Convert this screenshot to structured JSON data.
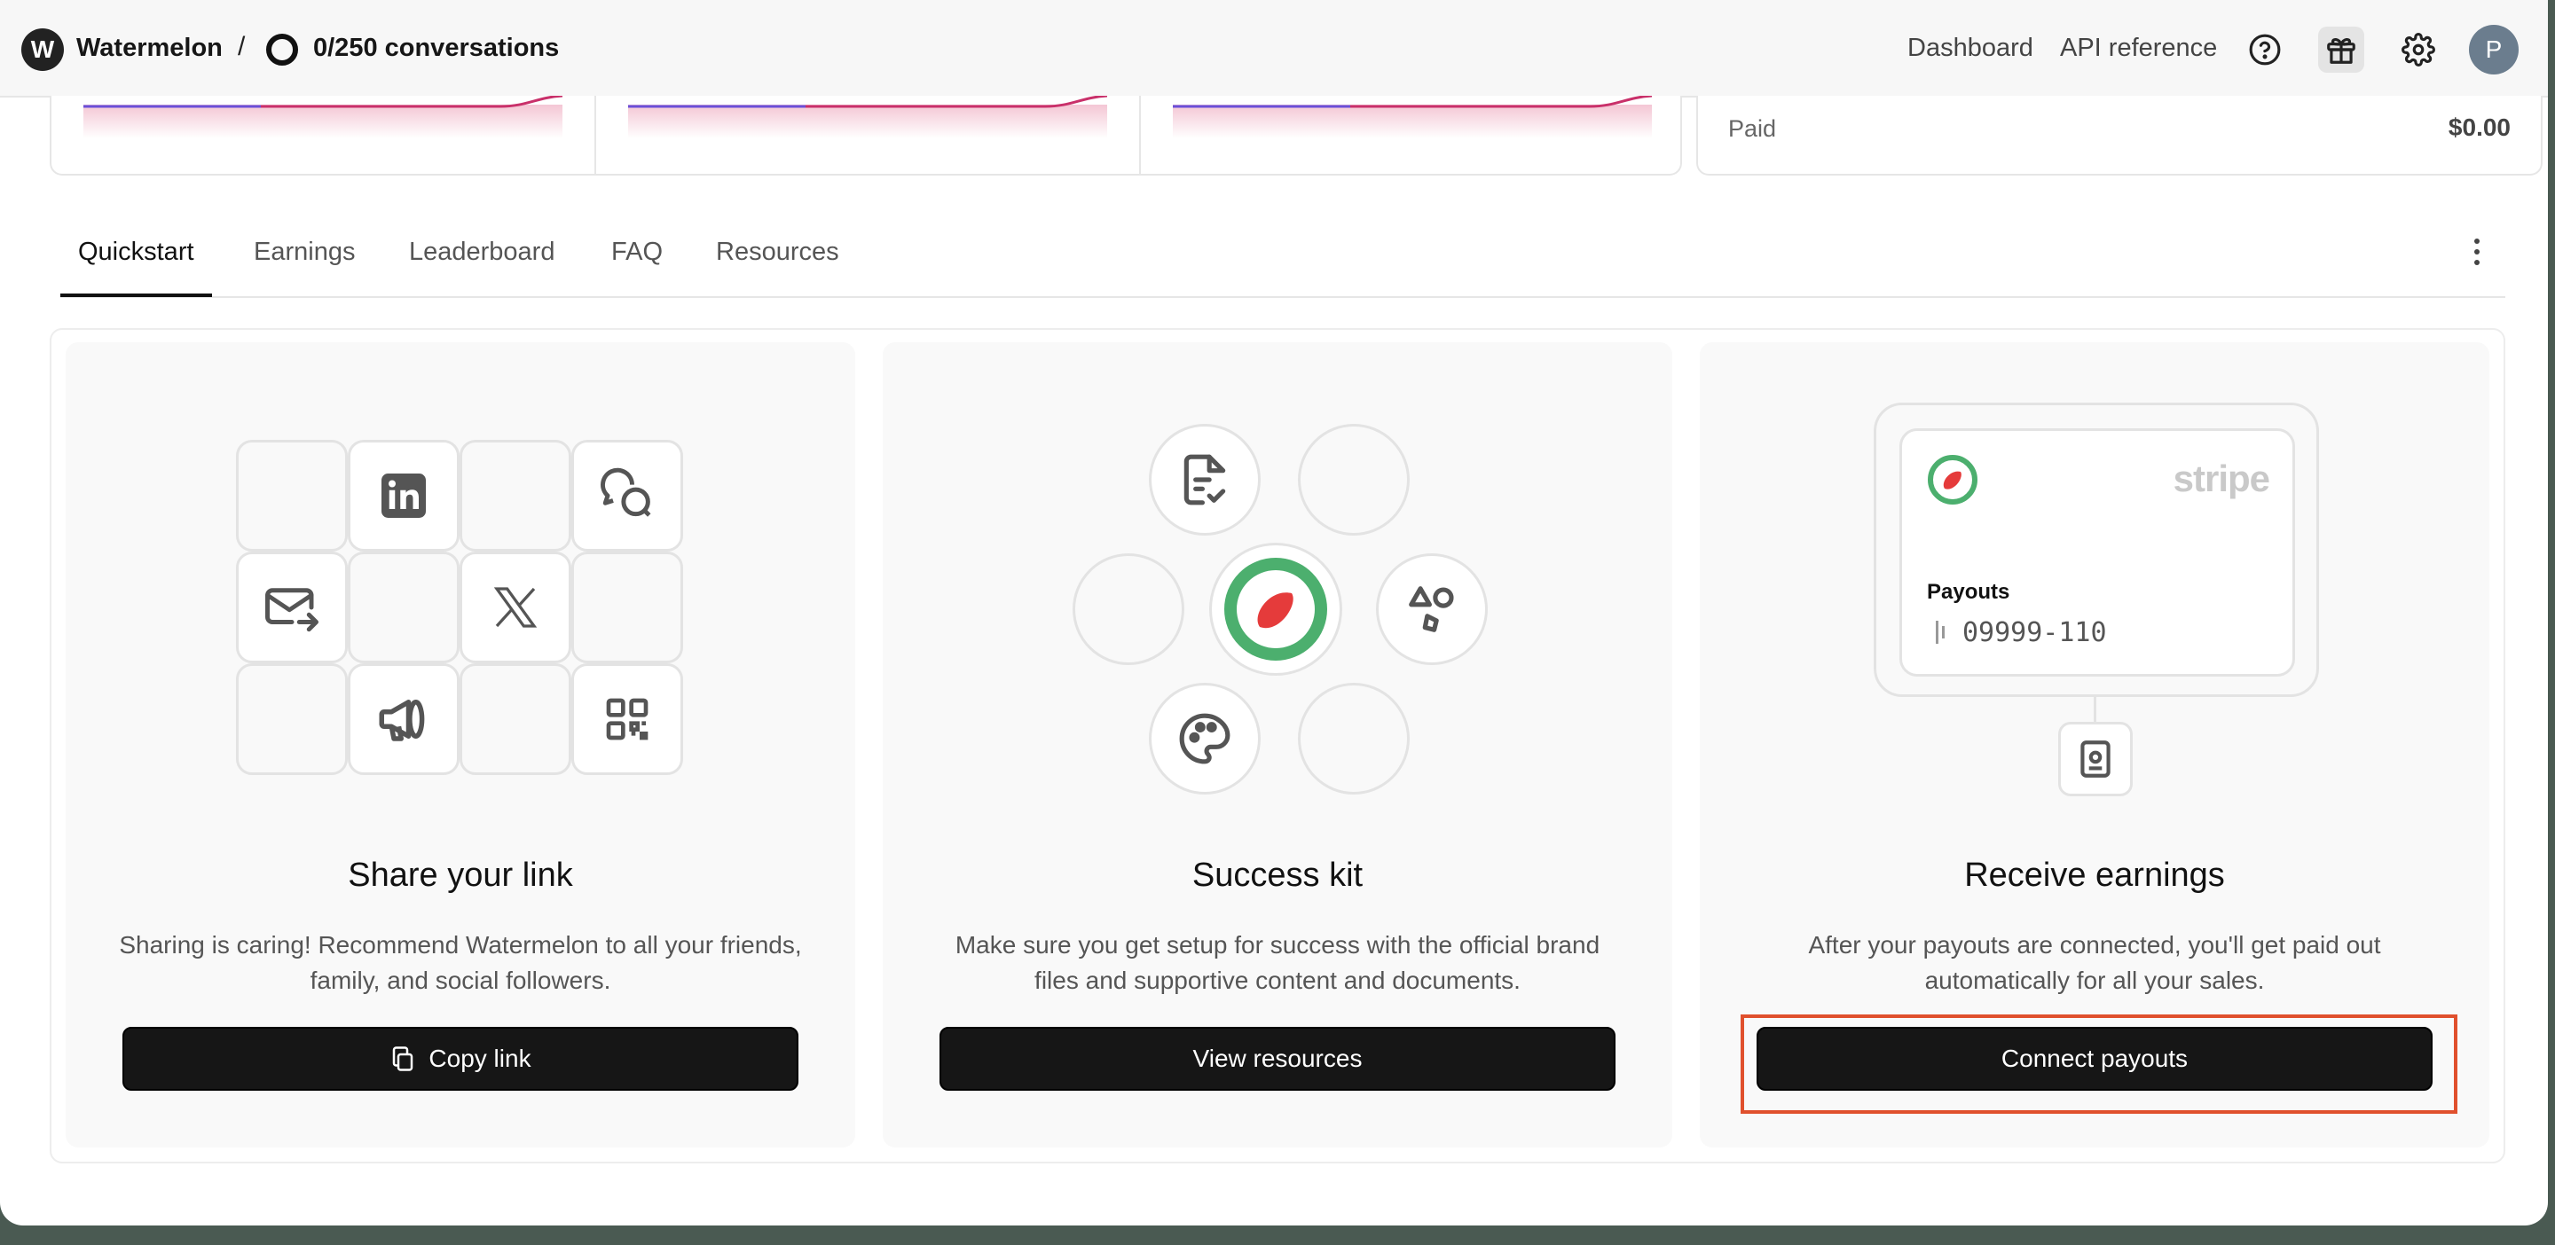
{
  "topbar": {
    "logo_letter": "W",
    "brand": "Watermelon",
    "separator": "/",
    "conversations": "0/250 conversations",
    "nav": {
      "dashboard": "Dashboard",
      "api_reference": "API reference"
    },
    "icons": [
      "help-circle-icon",
      "gift-icon",
      "gear-icon"
    ],
    "avatar_letter": "P"
  },
  "stats": {
    "paid_label": "Paid",
    "paid_value": "$0.00"
  },
  "tabs": [
    {
      "label": "Quickstart",
      "active": true
    },
    {
      "label": "Earnings",
      "active": false
    },
    {
      "label": "Leaderboard",
      "active": false
    },
    {
      "label": "FAQ",
      "active": false
    },
    {
      "label": "Resources",
      "active": false
    }
  ],
  "cards": {
    "share": {
      "title": "Share your link",
      "description": "Sharing is caring! Recommend Watermelon to all your friends, family, and social followers.",
      "button": "Copy link",
      "icons": [
        "linkedin-icon",
        "chat-bubbles-icon",
        "mail-forward-icon",
        "x-logo-icon",
        "megaphone-icon",
        "qr-code-icon"
      ]
    },
    "kit": {
      "title": "Success kit",
      "description": "Make sure you get setup for success with the official brand files and supportive content and documents.",
      "button": "View resources",
      "icons": [
        "document-check-icon",
        "watermelon-logo-icon",
        "shapes-icon",
        "palette-icon"
      ]
    },
    "earnings": {
      "title": "Receive earnings",
      "description": "After your payouts are connected, you'll get paid out automatically for all your sales.",
      "button": "Connect payouts",
      "stripe_word": "stripe",
      "payouts_label": "Payouts",
      "payouts_number": "09999-110"
    }
  },
  "colors": {
    "brand_green": "#4caf6e",
    "brand_red": "#e53b3b",
    "highlight": "#e0502d",
    "button_bg": "#161616"
  }
}
